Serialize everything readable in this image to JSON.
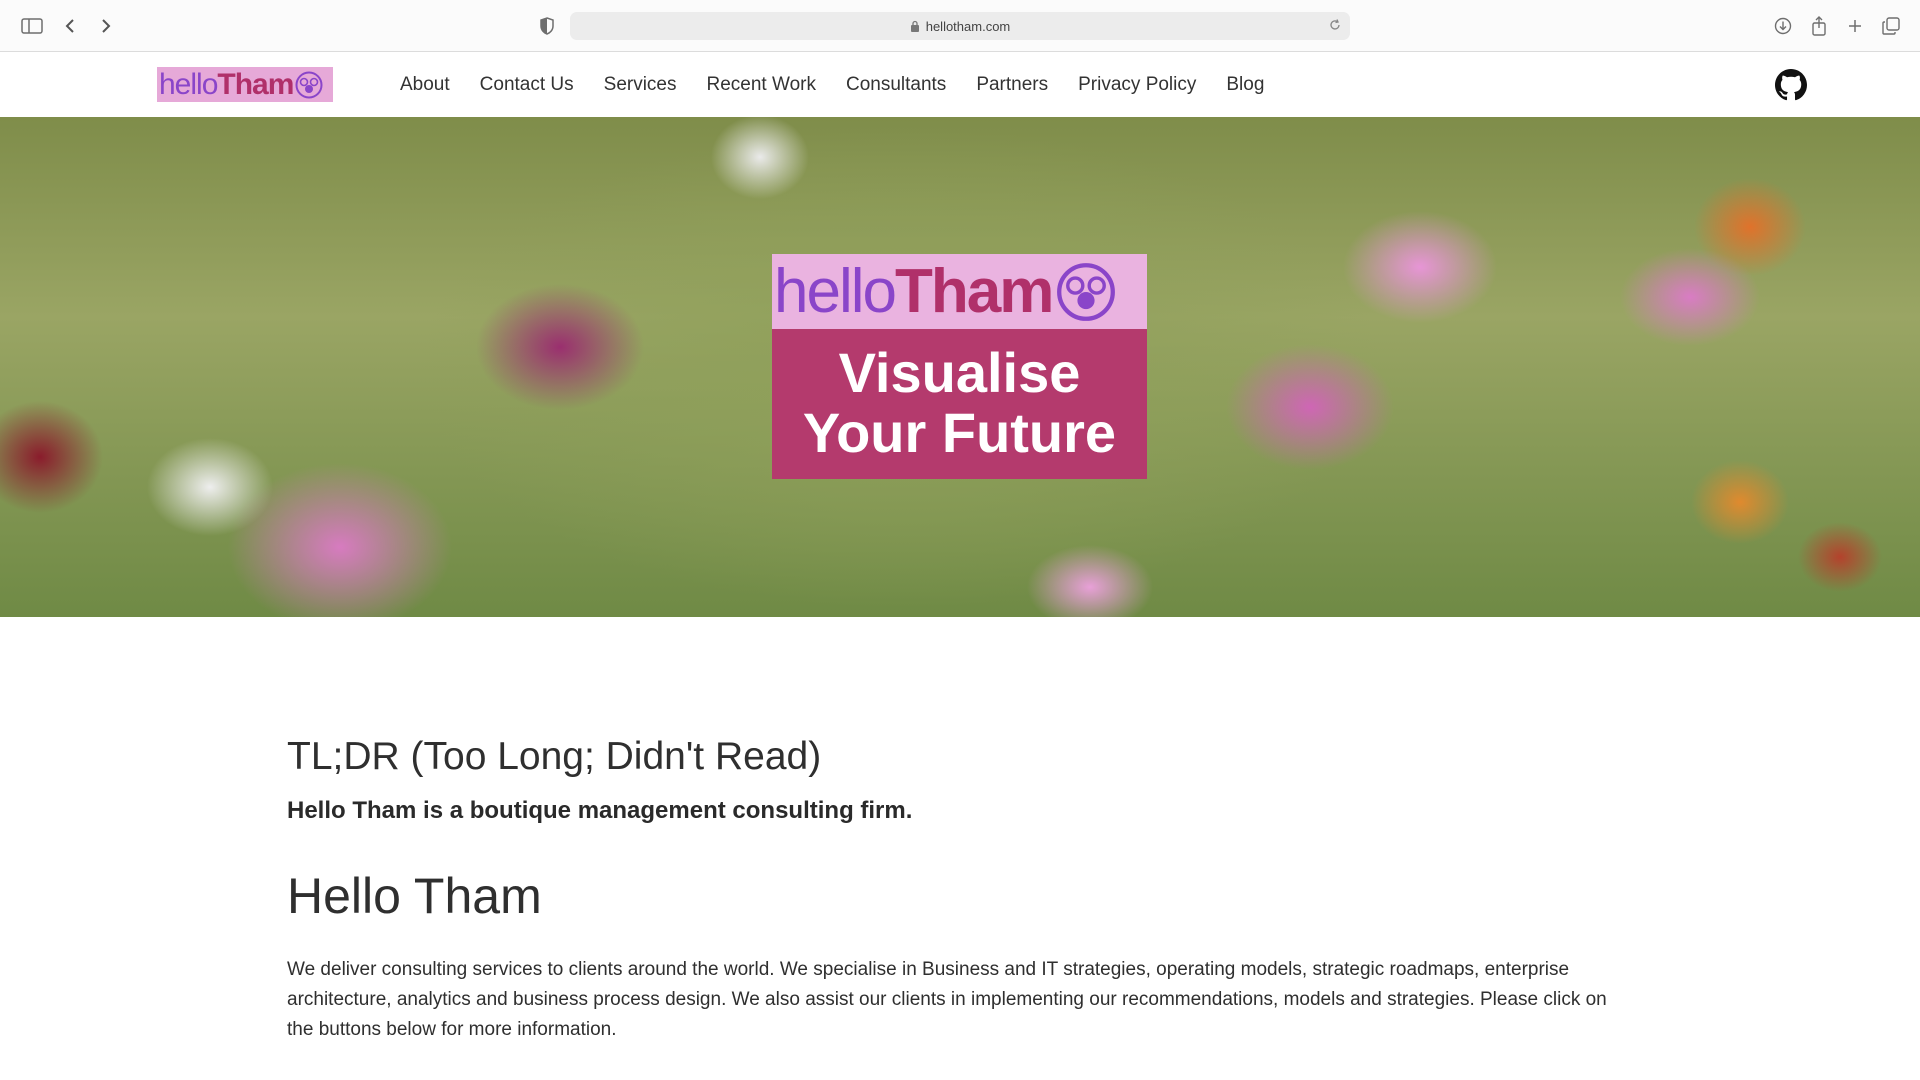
{
  "browser": {
    "url": "hellotham.com"
  },
  "nav": {
    "logo": {
      "hello": "hello",
      "tham": "Tham"
    },
    "items": [
      "About",
      "Contact Us",
      "Services",
      "Recent Work",
      "Consultants",
      "Partners",
      "Privacy Policy",
      "Blog"
    ],
    "github_icon": "github-icon"
  },
  "hero": {
    "badge_hello": "hello",
    "badge_tham": "Tham",
    "tagline_line1": "Visualise",
    "tagline_line2": "Your Future"
  },
  "content": {
    "tldr_heading": "TL;DR (Too Long; Didn't Read)",
    "tldr_text": "Hello Tham is a boutique management consulting firm.",
    "main_heading": "Hello Tham",
    "paragraph": "We deliver consulting services to clients around the world. We specialise in Business and IT strategies, operating models, strategic roadmaps, enterprise architecture, analytics and business process design. We also assist our clients in implementing our recommendations, models and strategies. Please click on the buttons below for more information."
  },
  "colors": {
    "logo_bg": "#e6a9d8",
    "logo_hello": "#8a45c9",
    "logo_tham": "#b0306a",
    "badge_bottom": "#b43a6d"
  }
}
